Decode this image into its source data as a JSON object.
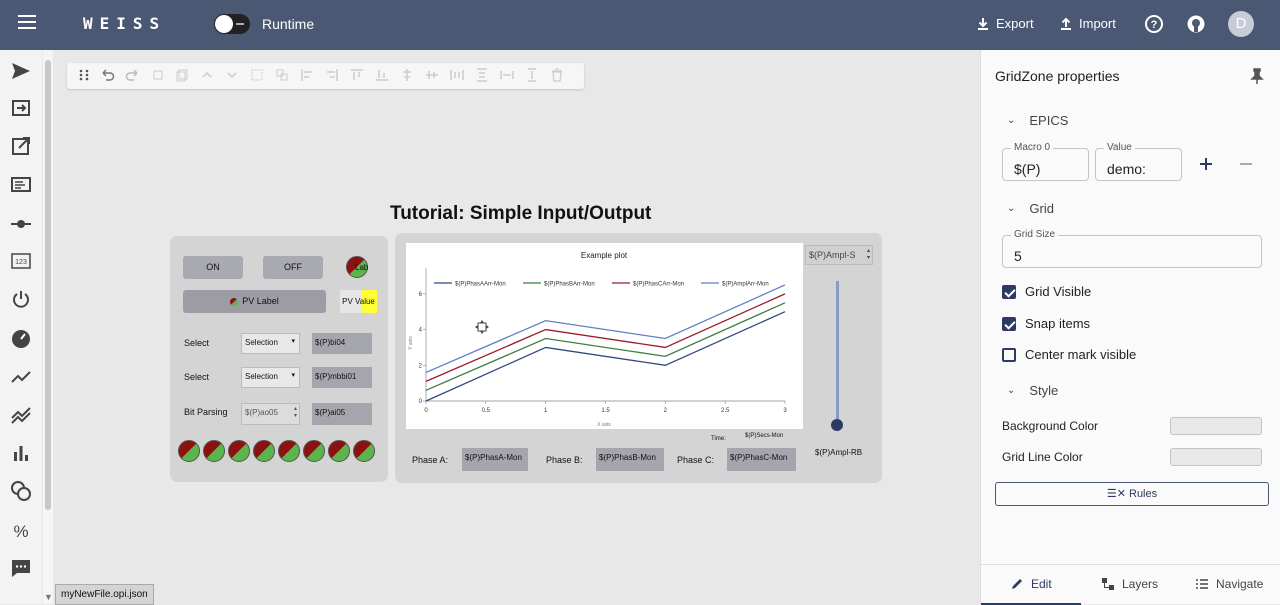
{
  "header": {
    "brand": "WEISS",
    "runtime_label": "Runtime",
    "export_label": "Export",
    "import_label": "Import",
    "avatar_initial": "D"
  },
  "sidebar_icons": [
    "send-icon",
    "input-icon",
    "external-link-icon",
    "text-fields-icon",
    "slider-icon",
    "numeric-123-icon",
    "power-icon",
    "gauge-icon",
    "line-chart-icon",
    "multi-line-chart-icon",
    "bar-chart-icon",
    "coins-icon",
    "percent-icon",
    "message-icon"
  ],
  "canvas": {
    "title": "Tutorial: Simple Input/Output",
    "left_panel": {
      "on_label": "ON",
      "off_label": "OFF",
      "led_label": "Lab",
      "pv_label": "PV Label",
      "pv_value": "PV Value",
      "select1_label": "Select",
      "select1_value": "Selection",
      "select1_pv": "$(P)bi04",
      "select2_label": "Select",
      "select2_value": "Selection",
      "select2_pv": "$(P)mbbi01",
      "bit_label": "Bit Parsing",
      "bit_input": "$(P)ao05",
      "bit_pv": "$(P)ai05"
    },
    "right_panel": {
      "ampl_select": "$(P)Ampl-S",
      "ampl_rb": "$(P)Ampl-RB",
      "time_label": "Time:",
      "time_pv": "$(P)Secs-Mon",
      "phase_a_label": "Phase A:",
      "phase_a_pv": "$(P)PhasA-Mon",
      "phase_b_label": "Phase B:",
      "phase_b_pv": "$(P)PhasB-Mon",
      "phase_c_label": "Phase C:",
      "phase_c_pv": "$(P)PhasC-Mon"
    }
  },
  "chart_data": {
    "type": "line",
    "title": "Example plot",
    "xlabel": "X axis",
    "ylabel": "Y axis",
    "x": [
      0,
      1,
      2,
      3
    ],
    "xlim": [
      0,
      3
    ],
    "ylim": [
      0,
      7
    ],
    "xticks": [
      "0",
      "0.5",
      "1",
      "1.5",
      "2",
      "2.5",
      "3"
    ],
    "yticks": [
      "0",
      "2",
      "4",
      "6"
    ],
    "legend_position": "top",
    "series": [
      {
        "name": "$(P)PhasAArr-Mon",
        "color": "#34497f",
        "values": [
          0,
          3.0,
          2.0,
          5.0
        ]
      },
      {
        "name": "$(P)PhasBArr-Mon",
        "color": "#3f7d3f",
        "values": [
          0.6,
          3.5,
          2.5,
          5.5
        ]
      },
      {
        "name": "$(P)PhasCArr-Mon",
        "color": "#9b1c2a",
        "values": [
          1.1,
          4.0,
          3.0,
          6.0
        ]
      },
      {
        "name": "$(P)AmplArr-Mon",
        "color": "#5d80c4",
        "values": [
          1.6,
          4.5,
          3.5,
          6.5
        ]
      }
    ]
  },
  "properties_panel": {
    "title": "GridZone properties",
    "epics_section": "EPICS",
    "macro_label": "Macro 0",
    "macro_value": "$(P)",
    "value_label": "Value",
    "value_value": "demo:",
    "grid_section": "Grid",
    "grid_size_label": "Grid Size",
    "grid_size_value": "5",
    "grid_visible_label": "Grid Visible",
    "snap_items_label": "Snap items",
    "center_mark_label": "Center mark visible",
    "style_section": "Style",
    "background_color_label": "Background Color",
    "grid_line_color_label": "Grid Line Color",
    "rules_label": "Rules",
    "tabs": {
      "edit": "Edit",
      "layers": "Layers",
      "navigate": "Navigate"
    }
  },
  "file_tab": "myNewFile.opi.json"
}
